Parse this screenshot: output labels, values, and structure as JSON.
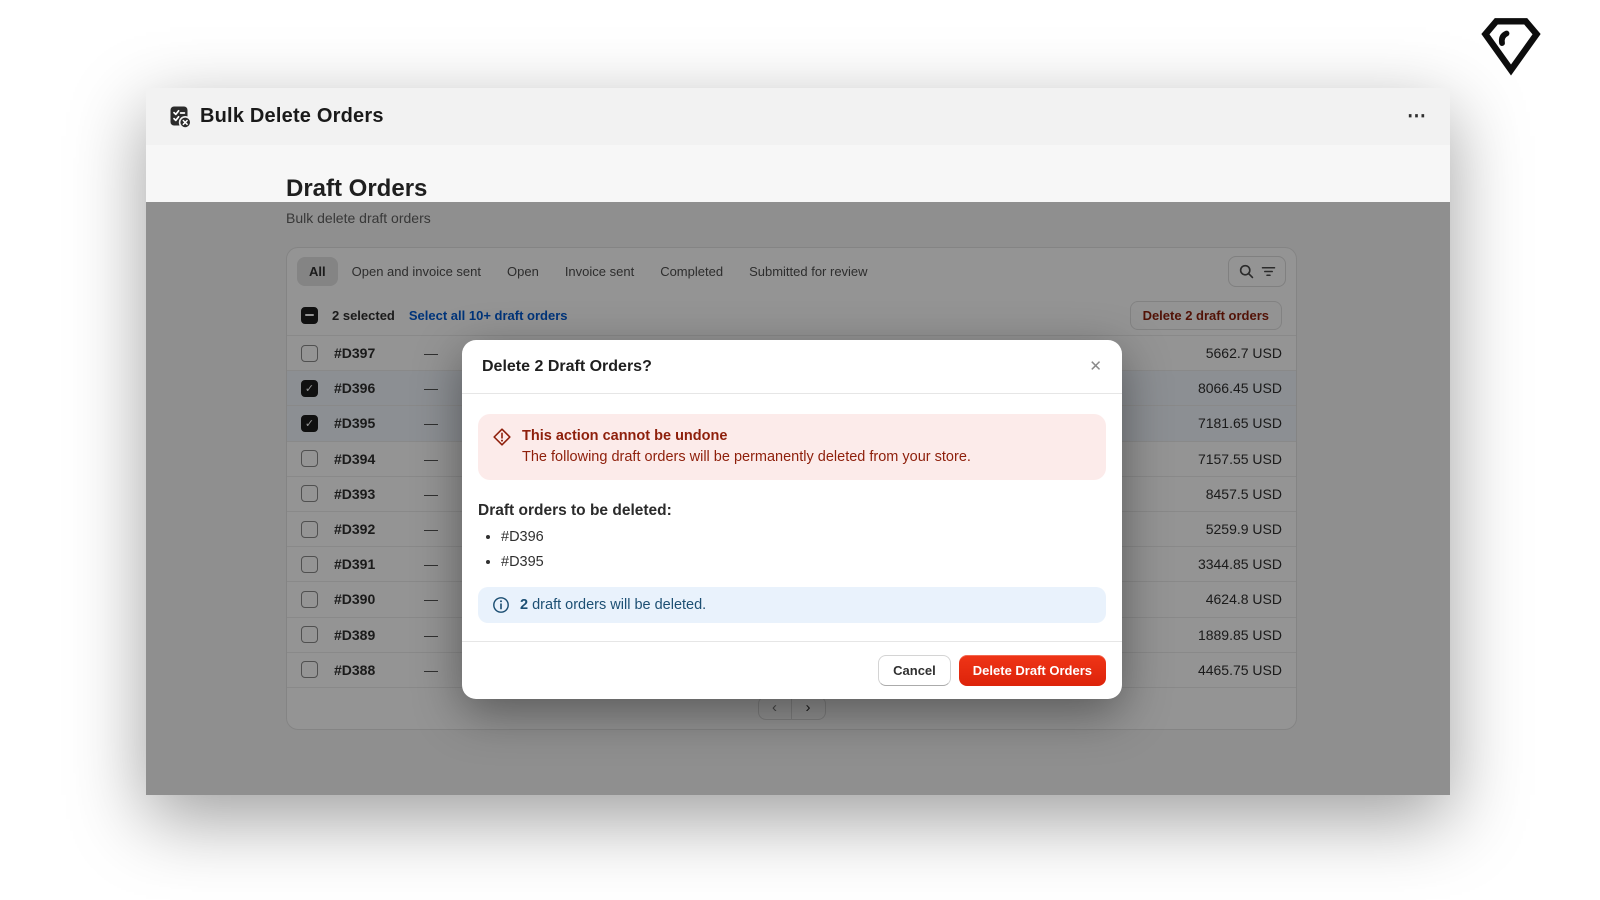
{
  "window": {
    "header": {
      "title": "Bulk Delete Orders",
      "menu_icon": "⋯"
    },
    "page": {
      "title": "Draft Orders",
      "subtitle": "Bulk delete draft orders"
    },
    "tabs": [
      "All",
      "Open and invoice sent",
      "Open",
      "Invoice sent",
      "Completed",
      "Submitted for review"
    ],
    "selected_tab_index": 0,
    "selection_bar": {
      "selected_text": "2 selected",
      "select_all_link": "Select all 10+ draft orders",
      "delete_button": "Delete 2 draft orders"
    },
    "row_dash": "—",
    "orders": [
      {
        "id": "#D397",
        "total": "5662.7 USD",
        "checked": false
      },
      {
        "id": "#D396",
        "total": "8066.45 USD",
        "checked": true
      },
      {
        "id": "#D395",
        "total": "7181.65 USD",
        "checked": true
      },
      {
        "id": "#D394",
        "total": "7157.55 USD",
        "checked": false
      },
      {
        "id": "#D393",
        "total": "8457.5 USD",
        "checked": false
      },
      {
        "id": "#D392",
        "total": "5259.9 USD",
        "checked": false
      },
      {
        "id": "#D391",
        "total": "3344.85 USD",
        "checked": false
      },
      {
        "id": "#D390",
        "total": "4624.8 USD",
        "checked": false
      },
      {
        "id": "#D389",
        "total": "1889.85 USD",
        "checked": false
      },
      {
        "id": "#D388",
        "total": "4465.75 USD",
        "checked": false
      }
    ],
    "pagination": {
      "prev_icon": "‹",
      "next_icon": "›"
    }
  },
  "modal": {
    "title": "Delete 2 Draft Orders?",
    "close_icon": "✕",
    "warning": {
      "title": "This action cannot be undone",
      "message": "The following draft orders will be permanently deleted from your store."
    },
    "list_heading": "Draft orders to be deleted:",
    "items": [
      "#D396",
      "#D395"
    ],
    "info": {
      "count": "2",
      "message": "draft orders will be deleted."
    },
    "cancel_label": "Cancel",
    "confirm_label": "Delete Draft Orders"
  },
  "icons": {
    "app": "clipboard-check-with-x-badge",
    "search": "magnifier",
    "filter": "three-lines",
    "warning": "alert-diamond",
    "info": "info-circle",
    "corner_logo": "black-gem-diamond-outline"
  },
  "colors": {
    "link_blue": "#005bd3",
    "critical_button_red": "#e22a0e",
    "critical_text_red": "#8e1f0b",
    "warning_banner_bg": "#fcebea",
    "info_banner_bg": "#e9f2fc",
    "info_text_blue": "#1c4f73",
    "selected_checkbox": "#1c1c1c"
  }
}
